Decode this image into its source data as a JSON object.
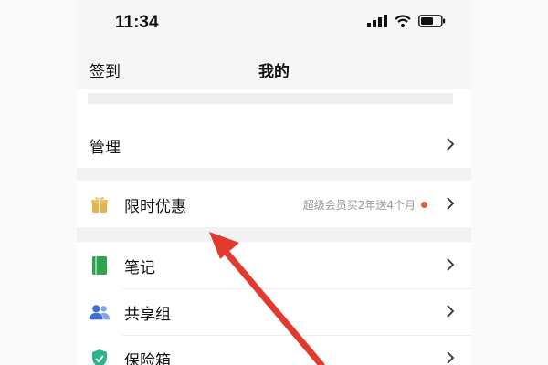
{
  "status_bar": {
    "time": "11:34"
  },
  "nav": {
    "left_label": "签到",
    "title": "我的"
  },
  "rows": {
    "manage": {
      "label": "管理"
    },
    "promo": {
      "label": "限时优惠",
      "subtext": "超级会员买2年送4个月"
    },
    "notes": {
      "label": "笔记"
    },
    "share_group": {
      "label": "共享组"
    },
    "vault": {
      "label": "保险箱"
    }
  },
  "icons": {
    "promo": "gift-icon",
    "notes": "notebook-icon",
    "share_group": "group-icon",
    "vault": "shield-icon"
  },
  "colors": {
    "gift": "#e8b24a",
    "notes": "#2fa24d",
    "group": "#3f6fd6",
    "vault": "#2bb38a",
    "badge_dot": "#e8553c",
    "arrow": "#e23a2e"
  }
}
